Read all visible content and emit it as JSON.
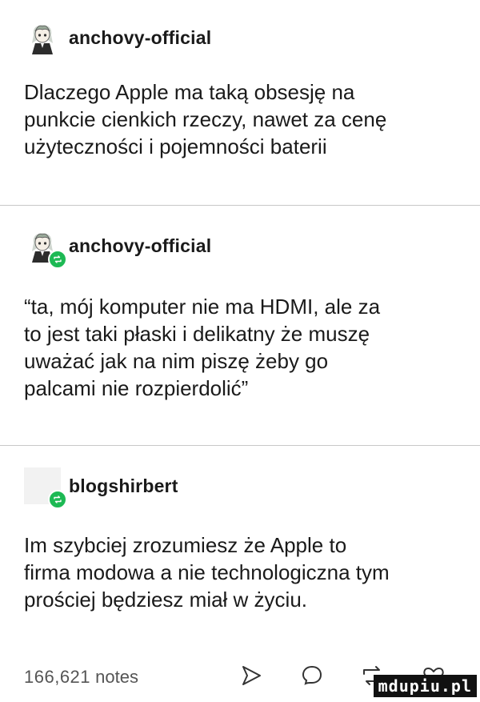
{
  "posts": [
    {
      "username": "anchovy-official",
      "text": "Dlaczego Apple ma taką obsesję na\npunkcie cienkich rzeczy, nawet za cenę\nużyteczności i pojemności baterii",
      "avatar_icon": "anime-girl-avatar-icon"
    },
    {
      "username": "anchovy-official",
      "text": "“ta, mój komputer nie ma HDMI, ale za\nto jest taki płaski i delikatny że muszę\nuważać jak na nim piszę żeby go\npalcami nie rozpierdolić”",
      "avatar_icon": "anime-girl-avatar-icon",
      "badge_icon": "reblog-icon"
    },
    {
      "username": "blogshirbert",
      "text": "Im szybciej zrozumiesz że Apple to\nfirma modowa a nie technologiczna tym\nprościej będziesz miał w życiu.",
      "avatar_icon": "blank-avatar-icon",
      "badge_icon": "reblog-icon"
    }
  ],
  "footer": {
    "notes_count": "166,621",
    "notes_label": "notes",
    "share_icon": "share-arrow-icon",
    "reply_icon": "reply-bubble-icon",
    "reblog_icon": "reblog-icon",
    "like_icon": "heart-icon"
  },
  "watermark": "mdupiu.pl",
  "colors": {
    "text": "#1a1a1a",
    "divider": "#c8c8c8",
    "badge": "#1db954",
    "watermark_bg": "#111111"
  }
}
